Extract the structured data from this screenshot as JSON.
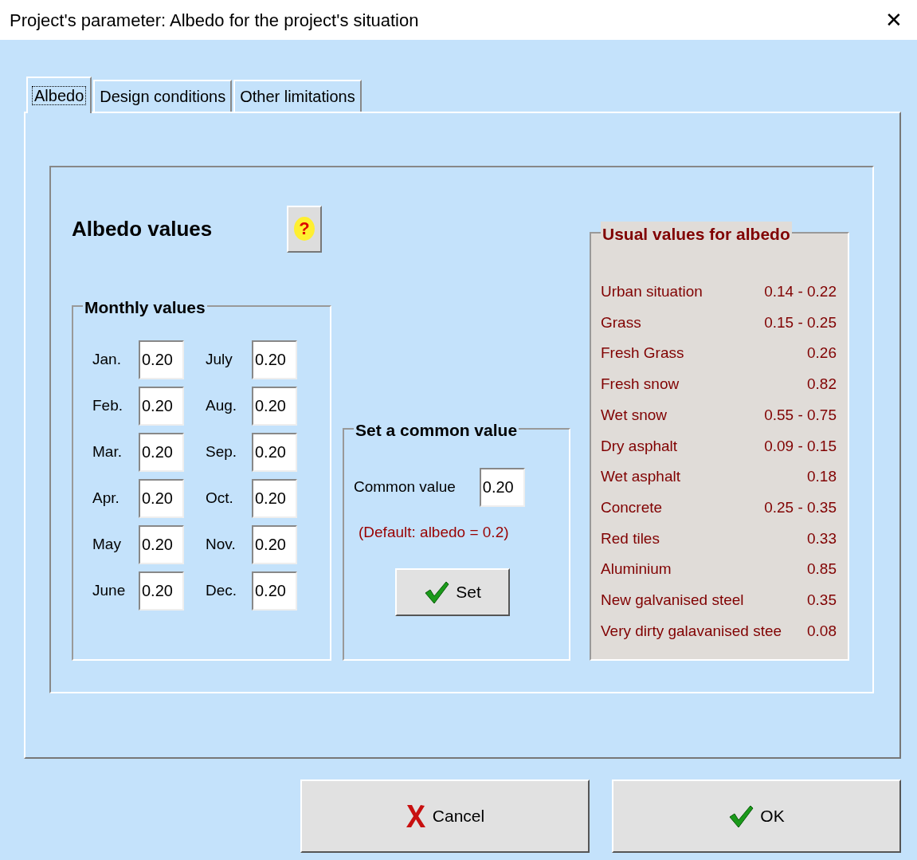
{
  "window": {
    "title": "Project's parameter: Albedo for the project's situation",
    "close": "✕"
  },
  "tabs": [
    {
      "label": "Albedo",
      "selected": true
    },
    {
      "label": "Design conditions",
      "selected": false
    },
    {
      "label": "Other limitations",
      "selected": false
    }
  ],
  "heading": "Albedo values",
  "help_button": "?",
  "monthly": {
    "title": "Monthly values",
    "months": [
      {
        "label": "Jan.",
        "value": "0.20"
      },
      {
        "label": "Feb.",
        "value": "0.20"
      },
      {
        "label": "Mar.",
        "value": "0.20"
      },
      {
        "label": "Apr.",
        "value": "0.20"
      },
      {
        "label": "May",
        "value": "0.20"
      },
      {
        "label": "June",
        "value": "0.20"
      },
      {
        "label": "July",
        "value": "0.20"
      },
      {
        "label": "Aug.",
        "value": "0.20"
      },
      {
        "label": "Sep.",
        "value": "0.20"
      },
      {
        "label": "Oct.",
        "value": "0.20"
      },
      {
        "label": "Nov.",
        "value": "0.20"
      },
      {
        "label": "Dec.",
        "value": "0.20"
      }
    ]
  },
  "common": {
    "title": "Set a common value",
    "label": "Common value",
    "value": "0.20",
    "note": "(Default: albedo = 0.2)",
    "button": "Set"
  },
  "usual": {
    "title": "Usual values for albedo",
    "rows": [
      {
        "name": "Urban situation",
        "value": "0.14 - 0.22"
      },
      {
        "name": "Grass",
        "value": "0.15 - 0.25"
      },
      {
        "name": "Fresh Grass",
        "value": "0.26"
      },
      {
        "name": "Fresh snow",
        "value": "0.82"
      },
      {
        "name": "Wet snow",
        "value": "0.55 - 0.75"
      },
      {
        "name": "Dry asphalt",
        "value": "0.09 - 0.15"
      },
      {
        "name": "Wet asphalt",
        "value": "0.18"
      },
      {
        "name": "Concrete",
        "value": "0.25 - 0.35"
      },
      {
        "name": "Red tiles",
        "value": "0.33"
      },
      {
        "name": "Aluminium",
        "value": "0.85"
      },
      {
        "name": "New galvanised steel",
        "value": "0.35"
      },
      {
        "name": "Very dirty galavanised stee",
        "value": "0.08"
      }
    ]
  },
  "buttons": [
    {
      "kind": "cancel",
      "label": "Cancel"
    },
    {
      "kind": "ok",
      "label": "OK"
    }
  ]
}
